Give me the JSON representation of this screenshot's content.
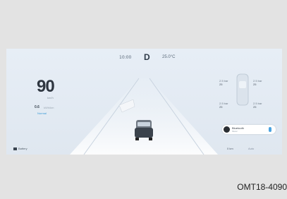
{
  "status": {
    "time": "10:00",
    "gear": "D",
    "temperature": "25.0°C"
  },
  "drive": {
    "speed": "90",
    "speed_unit": "km/h",
    "range_value": "0.6",
    "range_label": "kWh/km",
    "mode": "Normal"
  },
  "tires": {
    "fl": {
      "pressure": "2.5 bar",
      "temp": "25"
    },
    "fr": {
      "pressure": "2.5 bar",
      "temp": "25"
    },
    "rl": {
      "pressure": "2.5 bar",
      "temp": "25"
    },
    "rr": {
      "pressure": "2.5 bar",
      "temp": "25"
    }
  },
  "media": {
    "title": "Bluetooth",
    "subtitle": "Music"
  },
  "bottom": {
    "left_label": "Battery",
    "odometer": "0 km",
    "wiper": "Auto"
  },
  "caption": "OMT18-4090",
  "icons": [
    "battery-icon",
    "car-icon",
    "play-icon",
    "wiper-icon"
  ]
}
